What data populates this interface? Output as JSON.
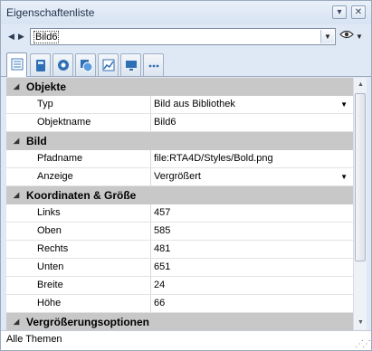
{
  "window": {
    "title": "Eigenschaftenliste"
  },
  "titlebar": {
    "pin_icon": "pin-icon",
    "close_icon": "close-icon"
  },
  "toolbar": {
    "selected_object": "Bild6",
    "prev_icon": "arrow-left-icon",
    "next_icon": "arrow-right-icon",
    "dropdown_icon": "chevron-down-icon",
    "eye_icon": "eye-icon"
  },
  "tabs": [
    {
      "icon": "list-icon",
      "active": true
    },
    {
      "icon": "object-icon",
      "active": false
    },
    {
      "icon": "gear-icon",
      "active": false
    },
    {
      "icon": "shapes-icon",
      "active": false
    },
    {
      "icon": "chart-icon",
      "active": false
    },
    {
      "icon": "monitor-icon",
      "active": false
    },
    {
      "icon": "more-icon",
      "active": false
    }
  ],
  "sections": {
    "objekte": {
      "label": "Objekte",
      "rows": [
        {
          "name": "Typ",
          "value": "Bild aus Bibliothek",
          "dropdown": true
        },
        {
          "name": "Objektname",
          "value": "Bild6",
          "dropdown": false
        }
      ]
    },
    "bild": {
      "label": "Bild",
      "rows": [
        {
          "name": "Pfadname",
          "value": "file:RTA4D/Styles/Bold.png",
          "dropdown": false
        },
        {
          "name": "Anzeige",
          "value": "Vergrößert",
          "dropdown": true
        }
      ]
    },
    "koordinaten": {
      "label": "Koordinaten & Größe",
      "rows": [
        {
          "name": "Links",
          "value": "457"
        },
        {
          "name": "Oben",
          "value": "585"
        },
        {
          "name": "Rechts",
          "value": "481"
        },
        {
          "name": "Unten",
          "value": "651"
        },
        {
          "name": "Breite",
          "value": "24"
        },
        {
          "name": "Höhe",
          "value": "66"
        }
      ]
    },
    "vergroesserung": {
      "label": "Vergrößerungsoptionen"
    }
  },
  "status": {
    "text": "Alle Themen"
  },
  "colors": {
    "category_bg": "#c8c8c8",
    "panel_bg": "#dfe9f5",
    "accent": "#1e2f4a"
  }
}
